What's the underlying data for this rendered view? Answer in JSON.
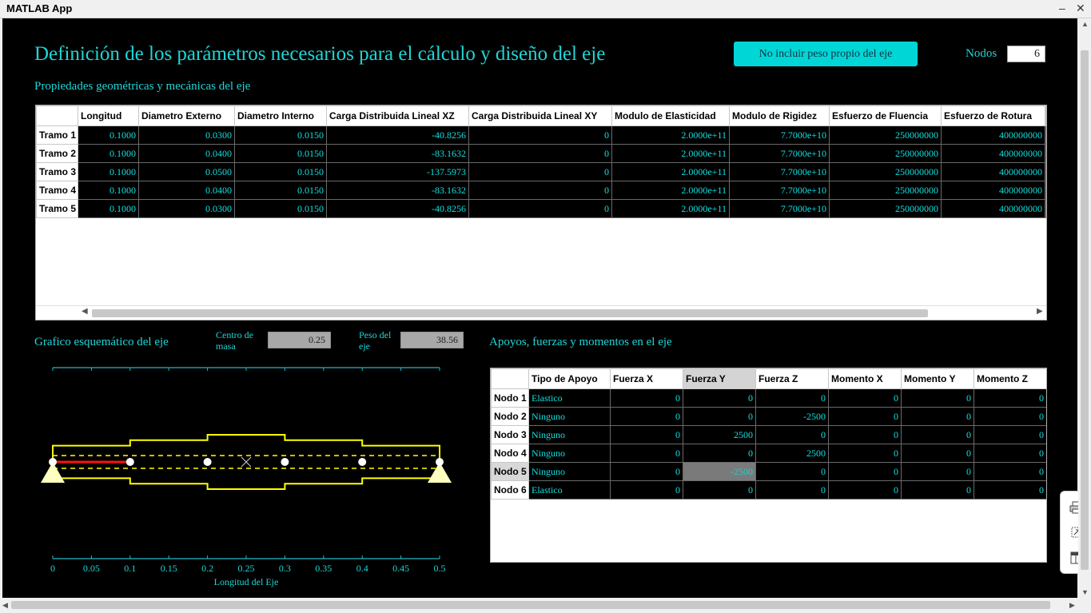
{
  "window": {
    "title": "MATLAB App"
  },
  "header": {
    "title": "Definición de los parámetros necesarios para el cálculo y diseño del eje",
    "peso_button": "No incluir peso propio del eje",
    "nodos_label": "Nodos",
    "nodos_value": "6"
  },
  "props": {
    "title": "Propiedades geométricas y mecánicas del eje",
    "columns": [
      "Longitud",
      "Diametro Externo",
      "Diametro Interno",
      "Carga Distribuida Lineal XZ",
      "Carga Distribuida Lineal XY",
      "Modulo de Elasticidad",
      "Modulo de Rigidez",
      "Esfuerzo de Fluencia",
      "Esfuerzo de Rotura"
    ],
    "rows": [
      {
        "name": "Tramo 1",
        "values": [
          "0.1000",
          "0.0300",
          "0.0150",
          "-40.8256",
          "0",
          "2.0000e+11",
          "7.7000e+10",
          "250000000",
          "400000000"
        ]
      },
      {
        "name": "Tramo 2",
        "values": [
          "0.1000",
          "0.0400",
          "0.0150",
          "-83.1632",
          "0",
          "2.0000e+11",
          "7.7000e+10",
          "250000000",
          "400000000"
        ]
      },
      {
        "name": "Tramo 3",
        "values": [
          "0.1000",
          "0.0500",
          "0.0150",
          "-137.5973",
          "0",
          "2.0000e+11",
          "7.7000e+10",
          "250000000",
          "400000000"
        ]
      },
      {
        "name": "Tramo 4",
        "values": [
          "0.1000",
          "0.0400",
          "0.0150",
          "-83.1632",
          "0",
          "2.0000e+11",
          "7.7000e+10",
          "250000000",
          "400000000"
        ]
      },
      {
        "name": "Tramo 5",
        "values": [
          "0.1000",
          "0.0300",
          "0.0150",
          "-40.8256",
          "0",
          "2.0000e+11",
          "7.7000e+10",
          "250000000",
          "400000000"
        ]
      }
    ]
  },
  "schematic": {
    "title": "Grafico esquemático del eje",
    "centro_label_1": "Centro de",
    "centro_label_2": "masa",
    "centro_value": "0.25",
    "peso_label_1": "Peso del",
    "peso_label_2": "eje",
    "peso_value": "38.56",
    "xlabel": "Longitud del Eje",
    "ticks": [
      "0",
      "0.05",
      "0.1",
      "0.15",
      "0.2",
      "0.25",
      "0.3",
      "0.35",
      "0.4",
      "0.45",
      "0.5"
    ],
    "tick_values": [
      0,
      0.05,
      0.1,
      0.15,
      0.2,
      0.25,
      0.3,
      0.35,
      0.4,
      0.45,
      0.5
    ],
    "xlim": [
      0,
      0.5
    ],
    "node_positions": [
      0,
      0.1,
      0.2,
      0.3,
      0.4,
      0.5
    ],
    "segment_diameters": [
      0.03,
      0.04,
      0.05,
      0.04,
      0.03
    ],
    "selected_segment": 1,
    "colors": {
      "axis": "#1fb8c8",
      "shaft": "#ffff00",
      "highlight": "#ff1010",
      "support": "#ffffc0",
      "node": "#ffffff"
    }
  },
  "apoyos": {
    "title": "Apoyos, fuerzas y momentos en el eje",
    "columns": [
      "Tipo de Apoyo",
      "Fuerza X",
      "Fuerza Y",
      "Fuerza Z",
      "Momento X",
      "Momento Y",
      "Momento Z"
    ],
    "rows": [
      {
        "name": "Nodo 1",
        "values": [
          "Elastico",
          "0",
          "0",
          "0",
          "0",
          "0",
          "0"
        ]
      },
      {
        "name": "Nodo 2",
        "values": [
          "Ninguno",
          "0",
          "0",
          "-2500",
          "0",
          "0",
          "0"
        ]
      },
      {
        "name": "Nodo 3",
        "values": [
          "Ninguno",
          "0",
          "2500",
          "0",
          "0",
          "0",
          "0"
        ]
      },
      {
        "name": "Nodo 4",
        "values": [
          "Ninguno",
          "0",
          "0",
          "2500",
          "0",
          "0",
          "0"
        ]
      },
      {
        "name": "Nodo 5",
        "values": [
          "Ninguno",
          "0",
          "-2500",
          "0",
          "0",
          "0",
          "0"
        ]
      },
      {
        "name": "Nodo 6",
        "values": [
          "Elastico",
          "0",
          "0",
          "0",
          "0",
          "0",
          "0"
        ]
      }
    ],
    "selected_row": 4,
    "selected_col": 2
  },
  "toolbar": {
    "icons": [
      "print-icon",
      "export-icon",
      "layout-icon"
    ]
  }
}
